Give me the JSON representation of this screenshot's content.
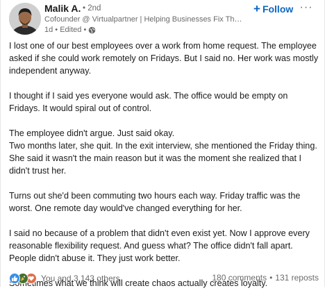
{
  "post": {
    "author": {
      "name": "Malik A.",
      "degree": "• 2nd",
      "headline": "Cofounder @ Virtualpartner | Helping Businesses Fix Their Pipeli...",
      "time": "1d • Edited •"
    },
    "follow_label": "Follow",
    "more_label": "···",
    "paragraphs": [
      "I lost one of our best employees over a work from home request. The employee asked if she could work remotely on Fridays. But I said no. Her work was mostly independent anyway.",
      "I thought if I said yes everyone would ask. The office would be empty on Fridays. It would spiral out of control.",
      "The employee didn't argue. Just said okay.",
      "Two months later, she quit. In the exit interview, she mentioned the Friday thing. She said it wasn't the main reason but it was the moment she realized that I didn't trust her.",
      "Turns out she'd been commuting two hours each way. Friday traffic was the worst. One remote day would've changed everything for her.",
      "I said no because of a problem that didn't even exist yet. Now I approve every reasonable flexibility request. And guess what? The office didn't fall apart. People didn't abuse it. They just work better.",
      "Sometimes what we think will create chaos actually creates loyalty."
    ]
  },
  "social": {
    "reactions_text": "You and 3,143 others",
    "comments_text": "180 comments",
    "separator": "•",
    "reposts_text": "131 reposts"
  },
  "colors": {
    "accent": "#0a66c2",
    "like": "#378fe9",
    "celebrate": "#44712e",
    "love": "#df704d"
  }
}
